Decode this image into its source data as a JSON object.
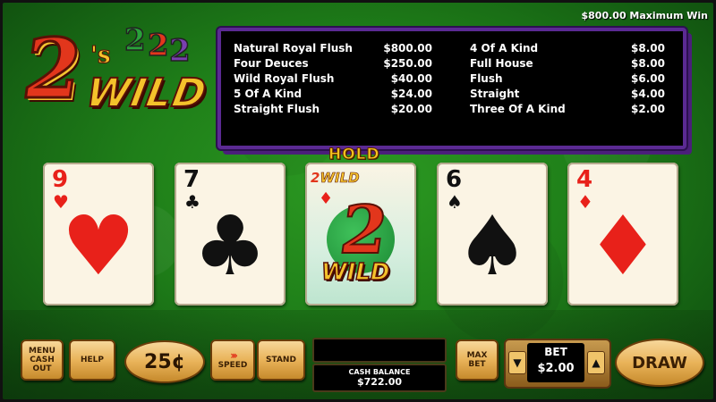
{
  "max_win": "$800.00 Maximum Win",
  "logo": {
    "two": "2",
    "apostrophe_s": "'s",
    "mini_twos": "22",
    "wild": "WILD"
  },
  "paytable": {
    "left": [
      {
        "hand": "Natural Royal Flush",
        "pay": "$800.00"
      },
      {
        "hand": "Four Deuces",
        "pay": "$250.00"
      },
      {
        "hand": "Wild Royal Flush",
        "pay": "$40.00"
      },
      {
        "hand": "5 Of A Kind",
        "pay": "$24.00"
      },
      {
        "hand": "Straight Flush",
        "pay": "$20.00"
      }
    ],
    "right": [
      {
        "hand": "4 Of A Kind",
        "pay": "$8.00"
      },
      {
        "hand": "Full House",
        "pay": "$8.00"
      },
      {
        "hand": "Flush",
        "pay": "$6.00"
      },
      {
        "hand": "Straight",
        "pay": "$4.00"
      },
      {
        "hand": "Three Of A Kind",
        "pay": "$2.00"
      }
    ]
  },
  "hold_label": "HOLD",
  "cards": [
    {
      "rank": "9",
      "suit": "♥",
      "color": "#e8211a",
      "held": false
    },
    {
      "rank": "7",
      "suit": "♣",
      "color": "#111111",
      "held": false
    },
    {
      "rank": "2",
      "suit": "♦",
      "color": "#e8211a",
      "held": true,
      "wild_top": "WILD",
      "wild_big": "WILD"
    },
    {
      "rank": "6",
      "suit": "♠",
      "color": "#111111",
      "held": false
    },
    {
      "rank": "4",
      "suit": "♦",
      "color": "#e8211a",
      "held": false
    }
  ],
  "buttons": {
    "menu_line1": "MENU",
    "menu_line2": "CASH",
    "menu_line3": "OUT",
    "help": "HELP",
    "denomination": "25¢",
    "speed": "SPEED",
    "speed_arrows": "›››",
    "stand": "STAND",
    "max_bet_line1": "MAX",
    "max_bet_line2": "BET",
    "draw": "DRAW",
    "bet_down": "▼",
    "bet_up": "▲"
  },
  "message": "",
  "cash_balance": {
    "label": "CASH BALANCE",
    "value": "$722.00"
  },
  "bet": {
    "label": "BET",
    "value": "$2.00"
  },
  "colors": {
    "felt": "#1f7f19",
    "paytable_border": "#5b2a93",
    "gold": "#f4c22b",
    "logo_red": "#e2361c"
  }
}
